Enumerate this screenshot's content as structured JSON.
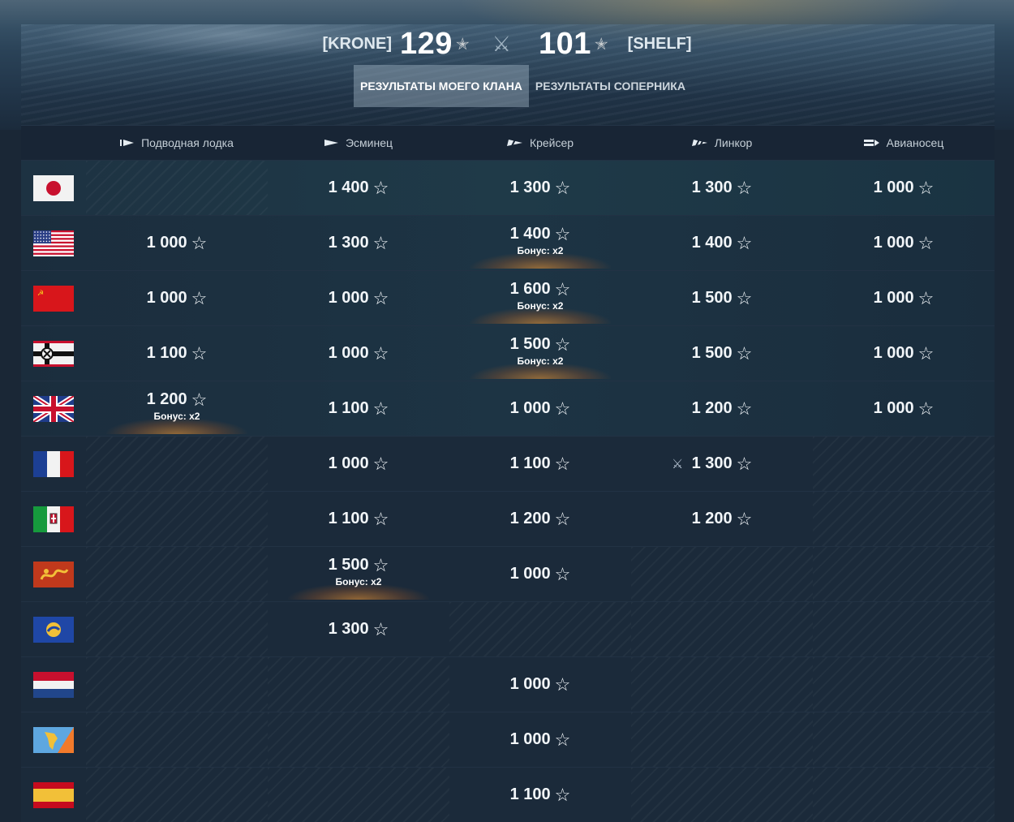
{
  "header": {
    "left_tag": "[KRONE]",
    "left_score": "129",
    "right_tag": "[SHELF]",
    "right_score": "101",
    "medal": "✭",
    "vs_icon": "crossed-swords-icon"
  },
  "tabs": [
    {
      "label": "РЕЗУЛЬТАТЫ МОЕГО КЛАНА",
      "active": true
    },
    {
      "label": "РЕЗУЛЬТАТЫ СОПЕРНИКА",
      "active": false
    }
  ],
  "columns": [
    "Подводная лодка",
    "Эсминец",
    "Крейсер",
    "Линкор",
    "Авианосец"
  ],
  "bonus_label": "Бонус: x2",
  "rows": [
    {
      "nation": "japan",
      "cells": [
        null,
        {
          "value": "1 400"
        },
        {
          "value": "1 300"
        },
        {
          "value": "1 300"
        },
        {
          "value": "1 000"
        }
      ]
    },
    {
      "nation": "usa",
      "cells": [
        {
          "value": "1 000"
        },
        {
          "value": "1 300"
        },
        {
          "value": "1 400",
          "bonus": true
        },
        {
          "value": "1 400"
        },
        {
          "value": "1 000"
        }
      ]
    },
    {
      "nation": "ussr",
      "cells": [
        {
          "value": "1 000"
        },
        {
          "value": "1 000"
        },
        {
          "value": "1 600",
          "bonus": true
        },
        {
          "value": "1 500"
        },
        {
          "value": "1 000"
        }
      ]
    },
    {
      "nation": "germany",
      "cells": [
        {
          "value": "1 100"
        },
        {
          "value": "1 000"
        },
        {
          "value": "1 500",
          "bonus": true
        },
        {
          "value": "1 500"
        },
        {
          "value": "1 000"
        }
      ]
    },
    {
      "nation": "uk",
      "cells": [
        {
          "value": "1 200",
          "bonus": true
        },
        {
          "value": "1 100"
        },
        {
          "value": "1 000"
        },
        {
          "value": "1 200"
        },
        {
          "value": "1 000"
        }
      ]
    },
    {
      "nation": "france",
      "cells": [
        null,
        {
          "value": "1 000"
        },
        {
          "value": "1 100"
        },
        {
          "value": "1 300",
          "battle": true
        },
        null
      ]
    },
    {
      "nation": "italy",
      "cells": [
        null,
        {
          "value": "1 100"
        },
        {
          "value": "1 200"
        },
        {
          "value": "1 200"
        },
        null
      ]
    },
    {
      "nation": "pan-asia",
      "cells": [
        null,
        {
          "value": "1 500",
          "bonus": true
        },
        {
          "value": "1 000"
        },
        null,
        null
      ]
    },
    {
      "nation": "europe",
      "cells": [
        null,
        {
          "value": "1 300"
        },
        null,
        null,
        null
      ]
    },
    {
      "nation": "netherlands",
      "cells": [
        null,
        null,
        {
          "value": "1 000"
        },
        null,
        null
      ]
    },
    {
      "nation": "pan-america",
      "cells": [
        null,
        null,
        {
          "value": "1 000"
        },
        null,
        null
      ]
    },
    {
      "nation": "spain",
      "cells": [
        null,
        null,
        {
          "value": "1 100"
        },
        null,
        null
      ]
    }
  ],
  "colors": {
    "accent_bonus": "#e8913a",
    "background": "#1a2736",
    "japan_row": "#1f3a48",
    "tab_active": "#7b8d9b"
  }
}
